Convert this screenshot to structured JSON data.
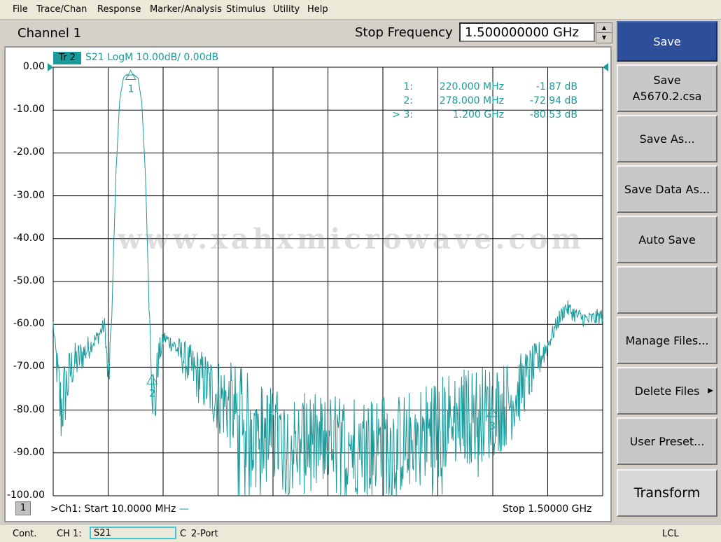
{
  "menu": [
    "File",
    "Trace/Chan",
    "Response",
    "Marker/Analysis",
    "Stimulus",
    "Utility",
    "Help"
  ],
  "channel": {
    "title": "Channel 1",
    "stop_freq_label": "Stop Frequency",
    "stop_freq_value": "1.500000000 GHz"
  },
  "trace": {
    "badge": "Tr 2",
    "label": "S21 LogM 10.00dB/  0.00dB",
    "color": "#1a9a9a"
  },
  "y_axis_labels": [
    "0.00",
    "-10.00",
    "-20.00",
    "-30.00",
    "-40.00",
    "-50.00",
    "-60.00",
    "-70.00",
    "-80.00",
    "-90.00",
    "-100.00"
  ],
  "markers": [
    {
      "id": "1:",
      "freq": "220.000 MHz",
      "value": "-1.87 dB"
    },
    {
      "id": "2:",
      "freq": "278.000 MHz",
      "value": "-72.94 dB"
    },
    {
      "id": "> 3:",
      "freq": "1.200 GHz",
      "value": "-80.53 dB"
    }
  ],
  "marker_labels": [
    "1",
    "2",
    "3"
  ],
  "watermark": "www.xahxmicrowave.com",
  "footer": {
    "ch_num": "1",
    "start": ">Ch1: Start  10.0000 MHz",
    "stop": "Stop  1.50000 GHz"
  },
  "softkeys": [
    {
      "label": "Save",
      "sub": ""
    },
    {
      "label": "Save",
      "sub": "A5670.2.csa"
    },
    {
      "label": "Save As...",
      "sub": ""
    },
    {
      "label": "Save Data As...",
      "sub": ""
    },
    {
      "label": "Auto Save",
      "sub": ""
    },
    {
      "label": "",
      "sub": ""
    },
    {
      "label": "Manage Files...",
      "sub": ""
    },
    {
      "label": "Delete Files",
      "sub": ""
    },
    {
      "label": "User Preset...",
      "sub": ""
    },
    {
      "label": "Transform",
      "sub": ""
    }
  ],
  "status": {
    "mode": "Cont.",
    "channel": "CH 1:",
    "param": "S21",
    "cal": "C",
    "port": "2-Port",
    "lcl": "LCL"
  },
  "chart_data": {
    "type": "line",
    "xlabel": "",
    "ylabel": "",
    "xlim_mhz": [
      10,
      1500
    ],
    "ylim": [
      -100,
      0
    ],
    "y_ticks": [
      0,
      -10,
      -20,
      -30,
      -40,
      -50,
      -60,
      -70,
      -80,
      -90,
      -100
    ],
    "grid": true,
    "series": [
      {
        "x_mhz": [
          10,
          30,
          60,
          100,
          130,
          150,
          160,
          170,
          180,
          190,
          200,
          210,
          220,
          230,
          240,
          250,
          260,
          270,
          278,
          285,
          295,
          310,
          340,
          380,
          450,
          550,
          650,
          750,
          850,
          950,
          1050,
          1100,
          1150,
          1200,
          1250,
          1300,
          1350,
          1380,
          1400,
          1430,
          1460,
          1500
        ],
        "y": [
          -60,
          -80,
          -70,
          -66,
          -63,
          -60,
          -75,
          -55,
          -25,
          -8,
          -2.5,
          -1.8,
          -1.87,
          -1.8,
          -2.5,
          -8,
          -25,
          -55,
          -72.94,
          -80,
          -68,
          -63,
          -65,
          -70,
          -76,
          -84,
          -88,
          -88,
          -88,
          -88,
          -84,
          -82,
          -81,
          -80.53,
          -78,
          -72,
          -65,
          -59,
          -56,
          -58,
          -59,
          -58
        ]
      }
    ]
  }
}
